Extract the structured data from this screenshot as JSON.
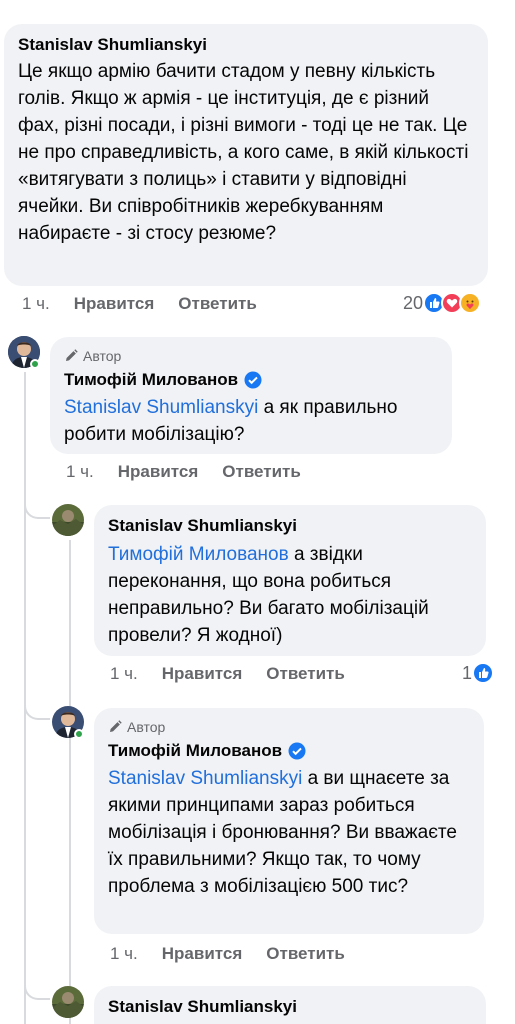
{
  "comment1": {
    "author": "Stanislav Shumlianskyi",
    "text": "Це якщо армію бачити стадом у певну кількість голів. Якщо ж армія - це інституція, де є різний фах, різні посади, і різні вимоги - тоді це не так. Це не про справедливість, а кого саме, в якій кількості «витягувати з полиць» і ставити у відповідні ячейки. Ви співробітників жеребкуванням набираєте - зі стосу резюме?",
    "time": "1 ч.",
    "like_label": "Нравится",
    "reply_label": "Ответить",
    "reaction_count": "20"
  },
  "reply1": {
    "badge": "Автор",
    "author": "Тимофій Милованов",
    "mention": "Stanislav Shumlianskyi",
    "text": " а як правильно робити мобілізацію?",
    "time": "1 ч.",
    "like_label": "Нравится",
    "reply_label": "Ответить"
  },
  "reply2": {
    "author": "Stanislav Shumlianskyi",
    "mention": "Тимофій Милованов",
    "text": " а звідки переконання, що вона робиться неправильно? Ви багато мобілізацій провели? Я жодної)",
    "time": "1 ч.",
    "like_label": "Нравится",
    "reply_label": "Ответить",
    "reaction_count": "1"
  },
  "reply3": {
    "badge": "Автор",
    "author": "Тимофій Милованов",
    "mention": "Stanislav Shumlianskyi",
    "text": " а ви щнаєете за якими принципами зараз робиться мобілізація і бронювання? Ви вважаєте їх правильними? Якщо так, то чому проблема з мобілізацією 500 тис?",
    "time": "1 ч.",
    "like_label": "Нравится",
    "reply_label": "Ответить"
  },
  "reply4": {
    "author": "Stanislav Shumlianskyi"
  },
  "colors": {
    "bubble": "#f0f2f5",
    "mention": "#216fdb",
    "meta": "#65676b",
    "like_blue": "#1877f2",
    "love_red": "#f33e58",
    "care_yellow": "#f7b125",
    "online_green": "#31a24c"
  },
  "icons": {
    "verified": "verified-badge-icon",
    "pencil": "pencil-icon",
    "like": "like-reaction-icon",
    "love": "love-reaction-icon",
    "care": "care-reaction-icon"
  }
}
